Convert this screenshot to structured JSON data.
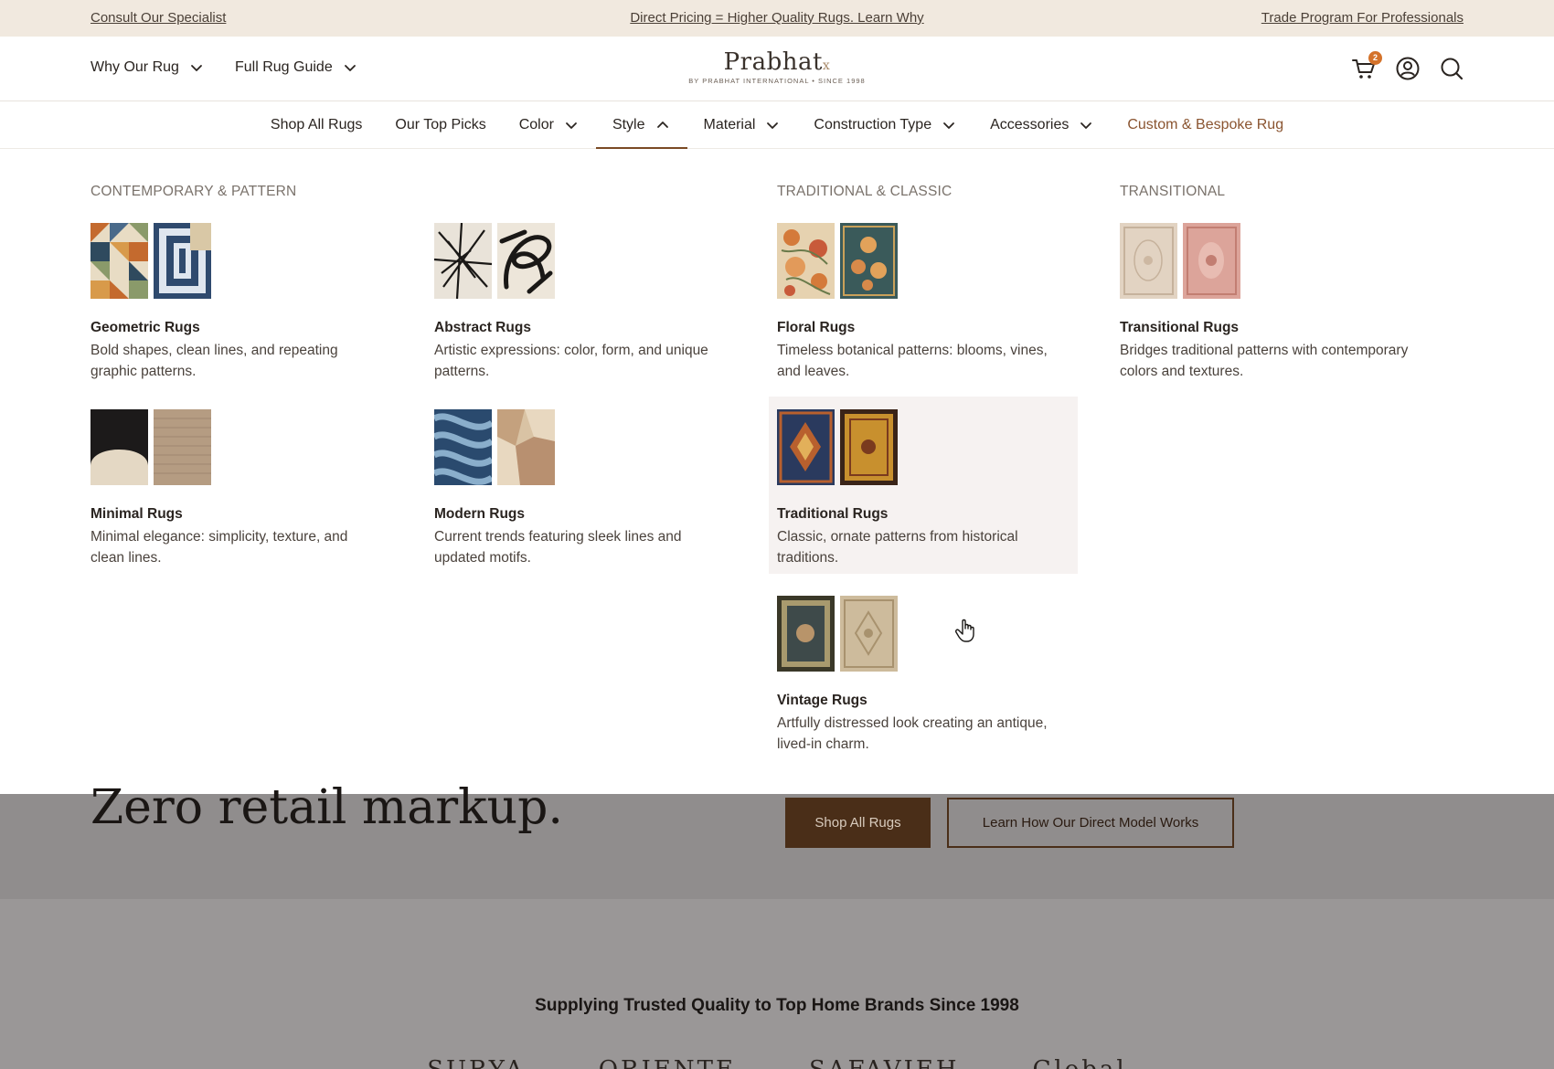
{
  "announcement": {
    "left": "Consult Our Specialist",
    "center": "Direct Pricing = Higher Quality Rugs. Learn Why",
    "right": "Trade Program For Professionals"
  },
  "header": {
    "nav_left": [
      "Why Our Rug",
      "Full Rug Guide"
    ],
    "logo_main": "Prabhat",
    "logo_x": "x",
    "logo_sub": "BY PRABHAT INTERNATIONAL • SINCE 1998",
    "cart_count": "2",
    "icons": [
      "cart-icon",
      "account-icon",
      "search-icon"
    ]
  },
  "main_nav": {
    "items": [
      {
        "label": "Shop All Rugs"
      },
      {
        "label": "Our Top Picks"
      },
      {
        "label": "Color"
      },
      {
        "label": "Style"
      },
      {
        "label": "Material"
      },
      {
        "label": "Construction Type"
      },
      {
        "label": "Accessories"
      },
      {
        "label": "Custom & Bespoke Rug"
      }
    ],
    "active": "Style",
    "accent_color": "#8a5430"
  },
  "mega_menu": {
    "columns": [
      {
        "heading": "CONTEMPORARY & PATTERN"
      },
      {
        "heading": "TRADITIONAL & CLASSIC"
      },
      {
        "heading": "TRANSITIONAL"
      }
    ],
    "cards": {
      "geometric": {
        "title": "Geometric Rugs",
        "desc": "Bold shapes, clean lines, and repeating graphic patterns."
      },
      "abstract": {
        "title": "Abstract Rugs",
        "desc": "Artistic expressions: color, form, and unique patterns."
      },
      "floral": {
        "title": "Floral Rugs",
        "desc": "Timeless botanical patterns: blooms, vines, and leaves."
      },
      "transitional": {
        "title": "Transitional Rugs",
        "desc": "Bridges traditional patterns with contemporary colors and textures."
      },
      "minimal": {
        "title": "Minimal Rugs",
        "desc": "Minimal elegance: simplicity, texture, and clean lines."
      },
      "modern": {
        "title": "Modern Rugs",
        "desc": "Current trends featuring sleek lines and updated motifs."
      },
      "traditional": {
        "title": "Traditional Rugs",
        "desc": "Classic, ornate patterns from historical traditions."
      },
      "vintage": {
        "title": "Vintage Rugs",
        "desc": "Artfully distressed look creating an antique, lived-in charm."
      }
    }
  },
  "page": {
    "hero_text": "Zero retail markup.",
    "shop_button": "Shop All Rugs",
    "learn_button": "Learn How Our Direct Model Works",
    "brands_title": "Supplying Trusted Quality to Top Home Brands Since 1998",
    "brand_logos": [
      "SURYA",
      "ORIENTE",
      "SAFAVIEH",
      "Global"
    ]
  }
}
